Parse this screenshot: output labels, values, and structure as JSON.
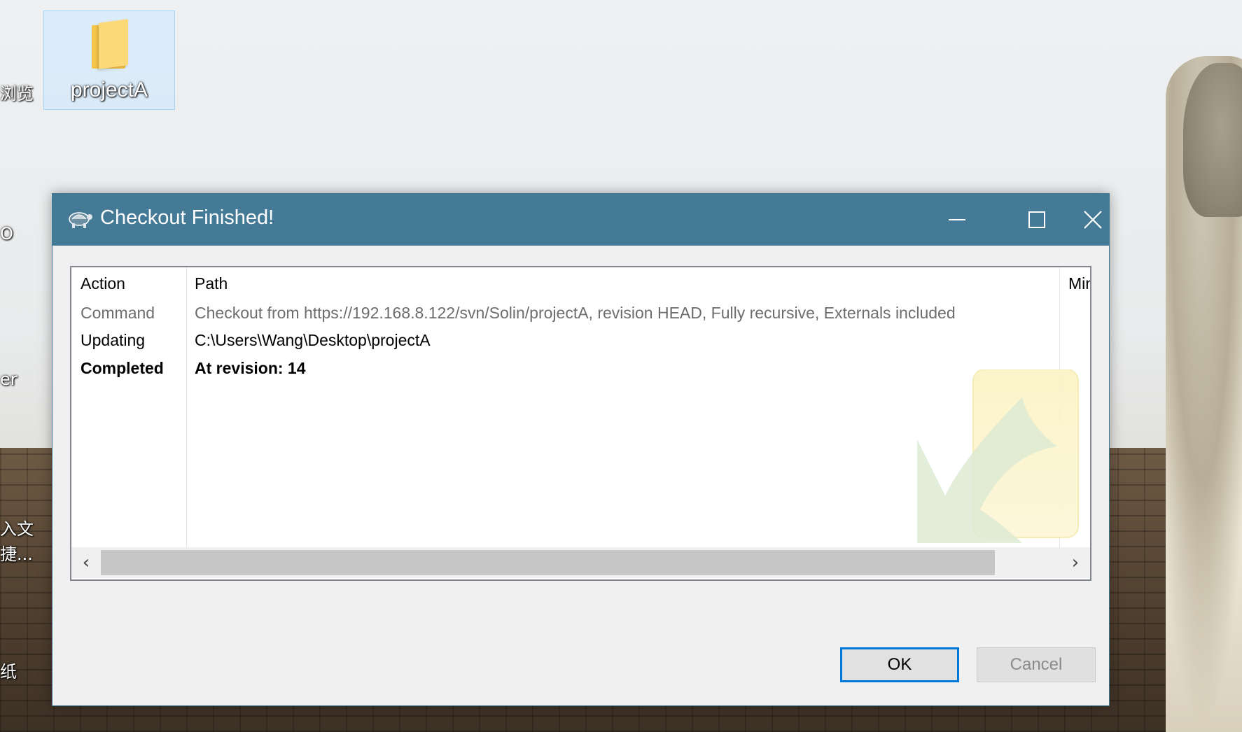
{
  "desktop": {
    "icon_label": "projectA",
    "left_fragments": [
      "浏览",
      "O",
      "er",
      "入文",
      "捷...",
      "纸"
    ]
  },
  "dialog": {
    "title": "Checkout Finished!",
    "columns": [
      "Action",
      "Path",
      "Min"
    ],
    "rows": [
      {
        "action": "Command",
        "path": "Checkout from https://192.168.8.122/svn/Solin/projectA, revision HEAD, Fully recursive, Externals included"
      },
      {
        "action": "Updating",
        "path": "C:\\Users\\Wang\\Desktop\\projectA"
      },
      {
        "action": "Completed",
        "path": "At revision: 14"
      }
    ],
    "ok_label": "OK",
    "cancel_label": "Cancel"
  },
  "colors": {
    "titlebar": "#447a96",
    "ok_border": "#0078d7"
  },
  "icons": [
    "folder-icon",
    "tortoise-icon",
    "minimize-icon",
    "maximize-icon",
    "close-icon",
    "scroll-left-icon",
    "scroll-right-icon",
    "checkmark-watermark-icon"
  ]
}
